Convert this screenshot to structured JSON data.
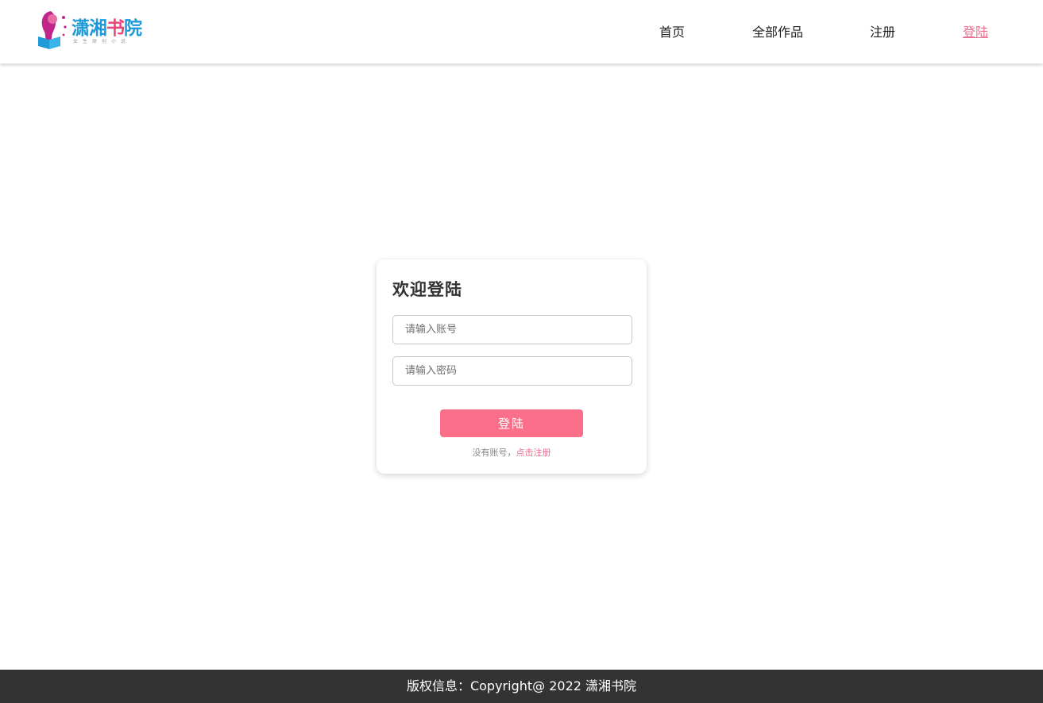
{
  "header": {
    "logo": {
      "title_part1": "潇湘",
      "title_part2": "书",
      "title_part3": "院",
      "subtitle": "女生原创小说"
    },
    "nav": [
      {
        "label": "首页"
      },
      {
        "label": "全部作品"
      },
      {
        "label": "注册"
      },
      {
        "label": "登陆",
        "active": true
      }
    ]
  },
  "login": {
    "title": "欢迎登陆",
    "account_placeholder": "请输入账号",
    "account_value": "",
    "password_placeholder": "请输入密码",
    "password_value": "",
    "submit_label": "登陆",
    "hint_text": "没有账号，",
    "register_link": "点击注册"
  },
  "footer": {
    "text": "版权信息：Copyright@ 2022 潇湘书院"
  },
  "colors": {
    "accent": "#fb6f8a",
    "link": "#ec6f8f",
    "footer_bg": "#333333",
    "logo_blue": "#1e9ad6",
    "logo_pink": "#e8457a"
  }
}
